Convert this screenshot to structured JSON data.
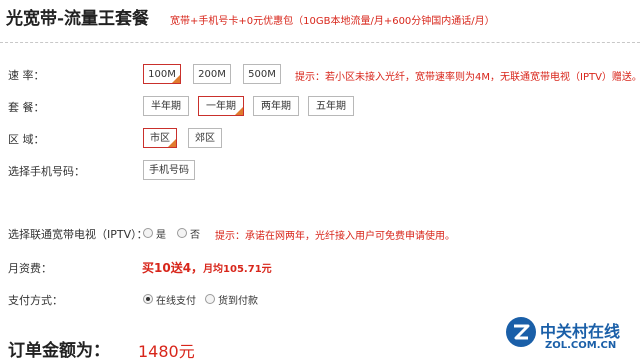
{
  "header": {
    "title": "光宽带-流量王套餐",
    "subtitle": "宽带+手机号卡+0元优惠包（10GB本地流量/月+600分钟国内通话/月）"
  },
  "speed": {
    "label": "速  率：",
    "options": [
      "100M",
      "200M",
      "500M"
    ],
    "selected": "100M",
    "hint": "提示：若小区未接入光纤，宽带速率则为4M，无联通宽带电视（IPTV）赠送。"
  },
  "package": {
    "label": "套  餐：",
    "options": [
      "半年期",
      "一年期",
      "两年期",
      "五年期"
    ],
    "selected": "一年期"
  },
  "area": {
    "label": "区  域：",
    "options": [
      "市区",
      "郊区"
    ],
    "selected": "市区"
  },
  "phone": {
    "label": "选择手机号码：",
    "button_label": "手机号码"
  },
  "iptv": {
    "label": "选择联通宽带电视（IPTV）：",
    "options": [
      "是",
      "否"
    ],
    "hint": "提示：承诺在网两年，光纤接入用户可免费申请使用。"
  },
  "monthly_fee": {
    "label": "月资费：",
    "promo": "买10送4，",
    "average": "月均105.71元"
  },
  "payment": {
    "label": "支付方式：",
    "options": [
      "在线支付",
      "货到付款"
    ],
    "selected": "在线支付"
  },
  "order_total": {
    "label": "订单金额为：",
    "value": "1480元"
  },
  "watermark": {
    "name": "中关村在线",
    "url": "ZOL.COM.CN"
  },
  "colors": {
    "accent_red": "#d8261b",
    "selected_corner": "#e07b2e",
    "watermark_blue": "#1a5fa8"
  }
}
